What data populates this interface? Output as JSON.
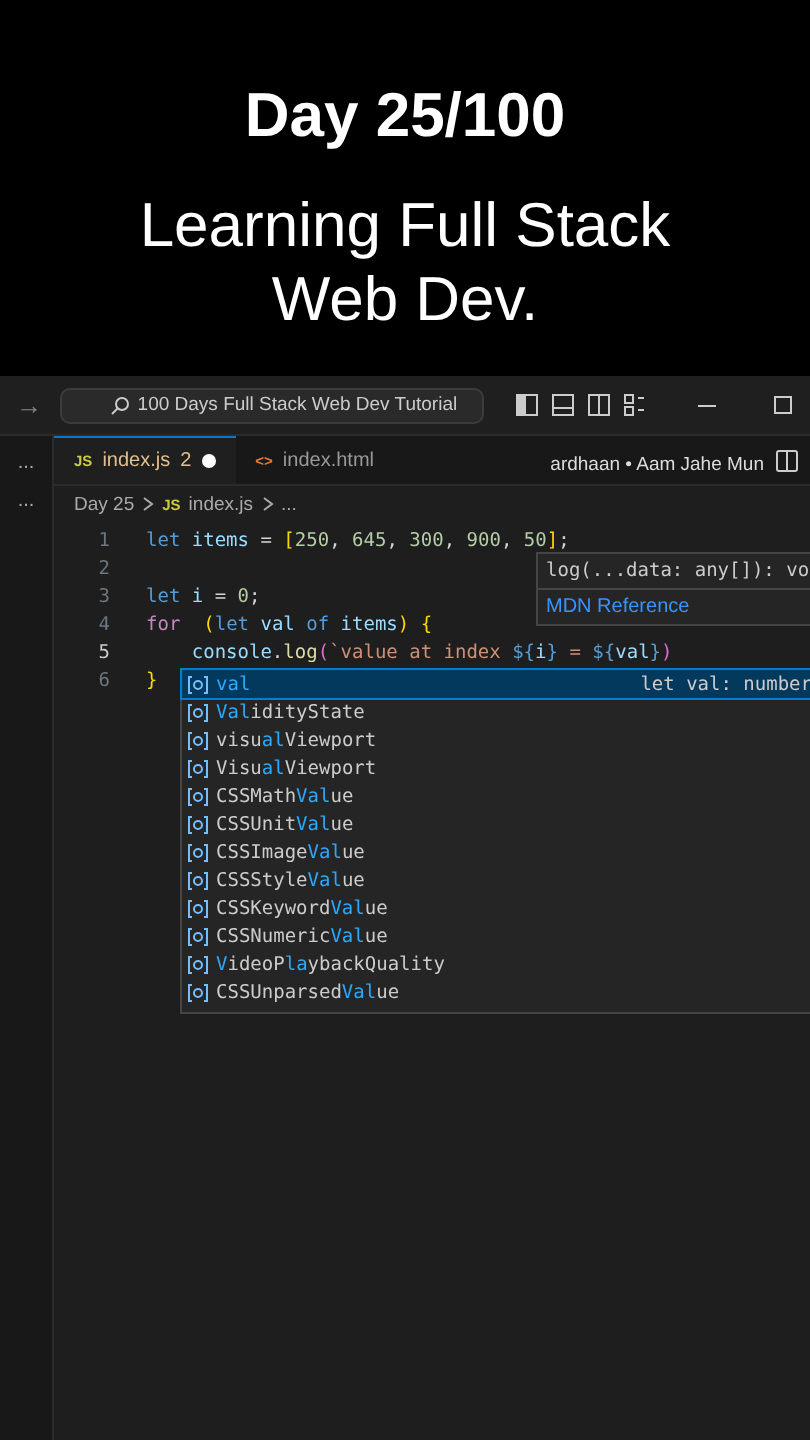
{
  "caption": {
    "title": "Day 25/100",
    "subtitle": "Learning Full Stack Web Dev."
  },
  "title_bar": {
    "back": "→",
    "search": "100 Days Full Stack Web Dev Tutorial"
  },
  "sidebar_more": [
    "...",
    "..."
  ],
  "tabs": [
    {
      "label": "index.js",
      "icon": "JS",
      "kind": "js",
      "problems": "2",
      "modified": true,
      "selected": true
    },
    {
      "label": "index.html",
      "icon": "<>",
      "kind": "html",
      "modified": false,
      "selected": false
    }
  ],
  "music_label": "ardhaan • Aam Jahe Mun",
  "breadcrumb": [
    {
      "label": "Day 25"
    },
    {
      "label": "index.js",
      "icon": "JS"
    },
    {
      "label": "..."
    }
  ],
  "code_lines": [
    {
      "number": "1",
      "active": false,
      "tokens": [
        {
          "text": "let ",
          "kind": "keyword"
        },
        {
          "text": "items",
          "kind": "variable"
        },
        {
          "text": " = ",
          "kind": "plain"
        },
        {
          "text": "[",
          "kind": "bracket"
        },
        {
          "text": "250",
          "kind": "number"
        },
        {
          "text": ", ",
          "kind": "plain"
        },
        {
          "text": "645",
          "kind": "number"
        },
        {
          "text": ", ",
          "kind": "plain"
        },
        {
          "text": "300",
          "kind": "number"
        },
        {
          "text": ", ",
          "kind": "plain"
        },
        {
          "text": "900",
          "kind": "number"
        },
        {
          "text": ", ",
          "kind": "plain"
        },
        {
          "text": "50",
          "kind": "number"
        },
        {
          "text": "]",
          "kind": "bracket"
        },
        {
          "text": ";",
          "kind": "plain"
        }
      ]
    },
    {
      "number": "2",
      "active": false
    },
    {
      "number": "3",
      "active": false,
      "tokens": [
        {
          "text": "let ",
          "kind": "keyword"
        },
        {
          "text": "i",
          "kind": "variable"
        },
        {
          "text": " = ",
          "kind": "plain"
        },
        {
          "text": "0",
          "kind": "number"
        },
        {
          "text": ";",
          "kind": "plain"
        }
      ]
    },
    {
      "number": "4",
      "active": false,
      "tokens": [
        {
          "text": "for  ",
          "kind": "control"
        },
        {
          "text": "(",
          "kind": "bracket"
        },
        {
          "text": "let ",
          "kind": "keyword"
        },
        {
          "text": "val ",
          "kind": "variable"
        },
        {
          "text": "of ",
          "kind": "keyword"
        },
        {
          "text": "items",
          "kind": "variable"
        },
        {
          "text": ") {",
          "kind": "bracket"
        }
      ]
    },
    {
      "number": "5",
      "active": true,
      "tokens": [
        {
          "text": "    console",
          "kind": "variable"
        },
        {
          "text": ".",
          "kind": "plain"
        },
        {
          "text": "log",
          "kind": "function"
        },
        {
          "text": "(",
          "kind": "paren"
        },
        {
          "text": "`value at index ",
          "kind": "string"
        },
        {
          "text": "${",
          "kind": "template"
        },
        {
          "text": "i",
          "kind": "variable"
        },
        {
          "text": "}",
          "kind": "template"
        },
        {
          "text": " = ",
          "kind": "string"
        },
        {
          "text": "${",
          "kind": "template"
        },
        {
          "text": "val",
          "kind": "variable"
        },
        {
          "text": "}",
          "kind": "template"
        },
        {
          "text": ")",
          "kind": "paren"
        }
      ]
    },
    {
      "number": "6",
      "active": false,
      "tokens": [
        {
          "text": "}",
          "kind": "bracket"
        }
      ]
    }
  ],
  "hover": {
    "signature": "log(...data: any[]): vo",
    "link": "MDN Reference"
  },
  "suggestions": [
    {
      "segments": [
        {
          "text": "val",
          "match": true
        }
      ],
      "detail": "let val: number",
      "selected": true
    },
    {
      "segments": [
        {
          "text": "Val",
          "match": true
        },
        {
          "text": "idityState",
          "match": false
        }
      ],
      "selected": false
    },
    {
      "segments": [
        {
          "text": "visu",
          "match": false
        },
        {
          "text": "al",
          "match": true
        },
        {
          "text": "Viewport",
          "match": false
        }
      ],
      "selected": false
    },
    {
      "segments": [
        {
          "text": "Visu",
          "match": false
        },
        {
          "text": "al",
          "match": true
        },
        {
          "text": "Viewport",
          "match": false
        }
      ],
      "selected": false
    },
    {
      "segments": [
        {
          "text": "CSSMath",
          "match": false
        },
        {
          "text": "Val",
          "match": true
        },
        {
          "text": "ue",
          "match": false
        }
      ],
      "selected": false
    },
    {
      "segments": [
        {
          "text": "CSSUnit",
          "match": false
        },
        {
          "text": "Val",
          "match": true
        },
        {
          "text": "ue",
          "match": false
        }
      ],
      "selected": false
    },
    {
      "segments": [
        {
          "text": "CSSImage",
          "match": false
        },
        {
          "text": "Val",
          "match": true
        },
        {
          "text": "ue",
          "match": false
        }
      ],
      "selected": false
    },
    {
      "segments": [
        {
          "text": "CSSStyle",
          "match": false
        },
        {
          "text": "Val",
          "match": true
        },
        {
          "text": "ue",
          "match": false
        }
      ],
      "selected": false
    },
    {
      "segments": [
        {
          "text": "CSSKeyword",
          "match": false
        },
        {
          "text": "Val",
          "match": true
        },
        {
          "text": "ue",
          "match": false
        }
      ],
      "selected": false
    },
    {
      "segments": [
        {
          "text": "CSSNumeric",
          "match": false
        },
        {
          "text": "Val",
          "match": true
        },
        {
          "text": "ue",
          "match": false
        }
      ],
      "selected": false
    },
    {
      "segments": [
        {
          "text": "V",
          "match": true
        },
        {
          "text": "ideoP",
          "match": false
        },
        {
          "text": "la",
          "match": true
        },
        {
          "text": "ybackQuality",
          "match": false
        }
      ],
      "selected": false
    },
    {
      "segments": [
        {
          "text": "CSSUnparsed",
          "match": false
        },
        {
          "text": "Val",
          "match": true
        },
        {
          "text": "ue",
          "match": false
        }
      ],
      "selected": false
    }
  ]
}
